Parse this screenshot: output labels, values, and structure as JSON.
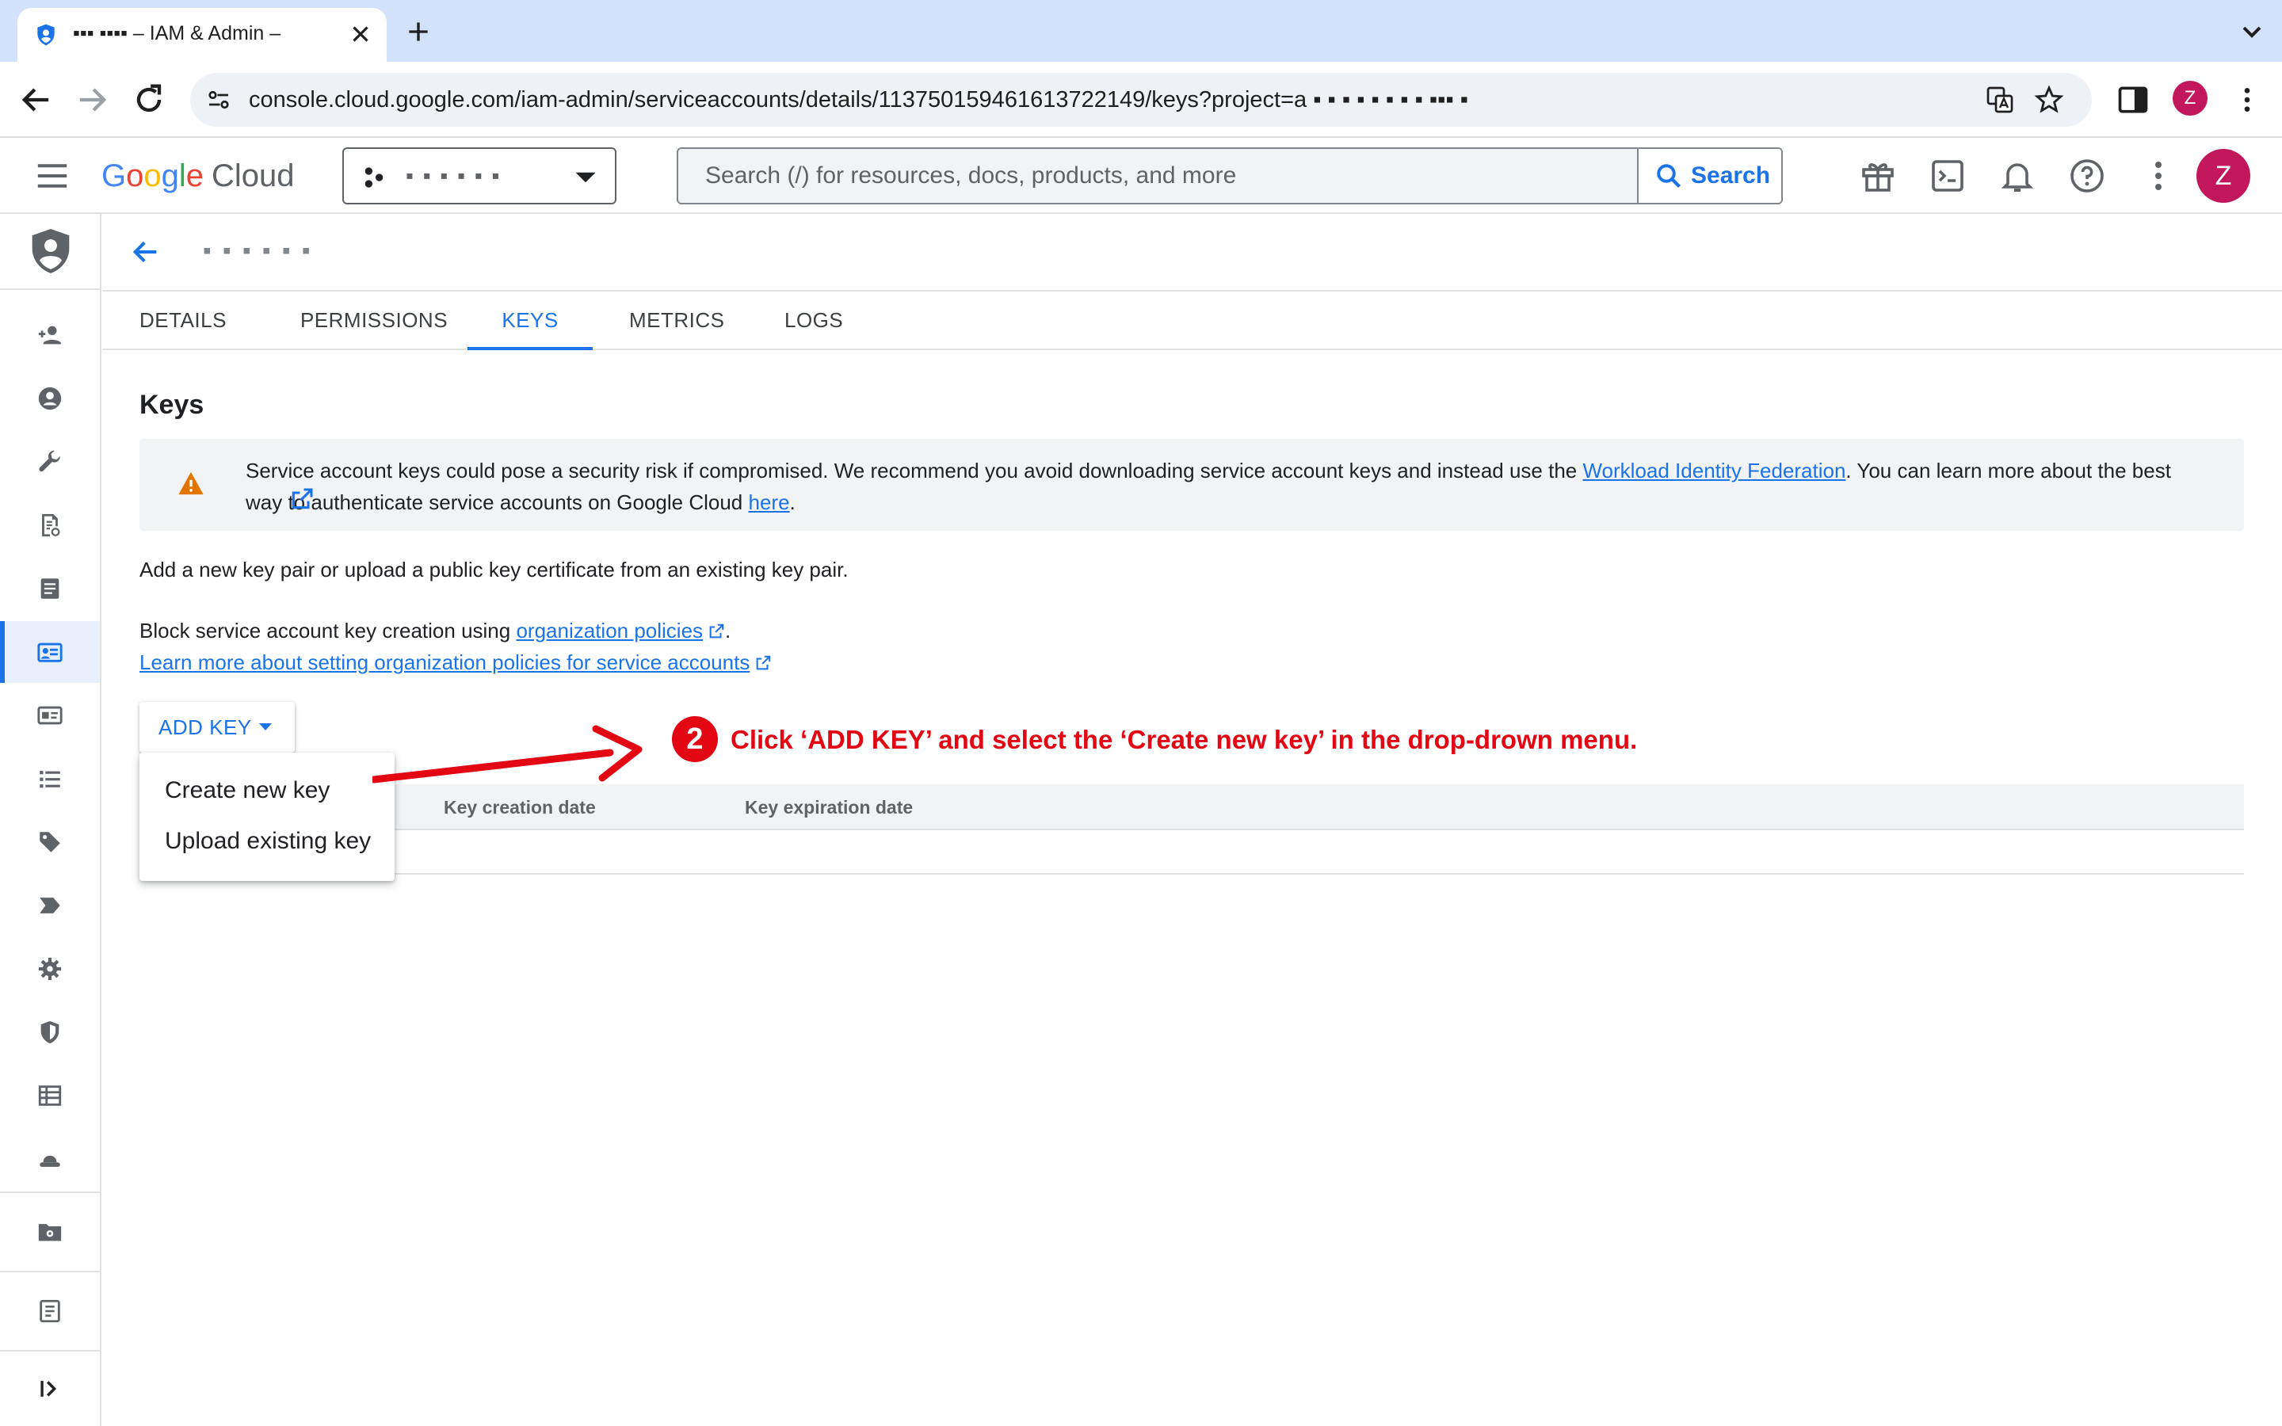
{
  "browser": {
    "tab_title": "▪▪▪ ▪▪▪▪ – IAM & Admin –",
    "url": "console.cloud.google.com/iam-admin/serviceaccounts/details/113750159461613722149/keys?project=a ▪ ▪ ▪ ▪ ▪ ▪ ▪ ▪ ▪▪▪ ▪",
    "profile_initial": "Z"
  },
  "header": {
    "logo": {
      "g": "G",
      "o1": "o",
      "o2": "o",
      "g2": "g",
      "l": "l",
      "e": "e",
      "cloud": "Cloud"
    },
    "project_name": "▪ ▪ ▪ ▪  ▪ ▪",
    "search_placeholder": "Search (/) for resources, docs, products, and more",
    "search_button": "Search",
    "avatar_initial": "Z"
  },
  "page": {
    "account_name": "▪ ▪ ▪ ▪ ▪ ▪",
    "tabs": [
      {
        "label": "DETAILS"
      },
      {
        "label": "PERMISSIONS"
      },
      {
        "label": "KEYS"
      },
      {
        "label": "METRICS"
      },
      {
        "label": "LOGS"
      }
    ],
    "active_tab": "KEYS"
  },
  "content": {
    "heading": "Keys",
    "warning": {
      "text_before": "Service account keys could pose a security risk if compromised. We recommend you avoid downloading service account keys and instead use the ",
      "link1": "Workload Identity Federation",
      "text_middle": ". You can learn more about the best way to authenticate service accounts on Google Cloud ",
      "link2": "here",
      "text_after": "."
    },
    "info_line": "Add a new key pair or upload a public key certificate from an existing key pair.",
    "block_text": "Block service account key creation using ",
    "block_link": "organization policies",
    "block_after": ".",
    "learn_more_link": "Learn more about setting organization policies for service accounts",
    "add_key_button": "ADD KEY",
    "menu": [
      {
        "label": "Create new key"
      },
      {
        "label": "Upload existing key"
      }
    ],
    "table_columns": [
      {
        "label": "Key creation date"
      },
      {
        "label": "Key expiration date"
      }
    ]
  },
  "annotation": {
    "step_number": "2",
    "instruction": "Click ‘ADD KEY’ and select the ‘Create new key’ in the drop-drown menu.",
    "color": "#e30613"
  },
  "icons": {
    "rail": [
      "iam-shield-icon",
      "add-person-icon",
      "account-circle-icon",
      "wrench-icon",
      "policy-document-icon",
      "document-icon",
      "service-account-icon",
      "id-card-icon",
      "list-icon",
      "tag-icon",
      "label-arrow-icon",
      "settings-gear-icon",
      "security-shield-icon",
      "table-icon",
      "hat-icon",
      "folder-gear-icon",
      "clipboard-icon",
      "expand-rail-icon"
    ]
  }
}
